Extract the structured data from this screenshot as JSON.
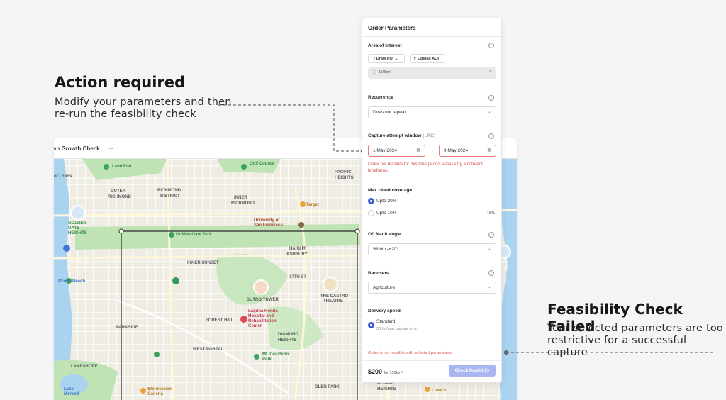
{
  "callouts": {
    "action": {
      "title": "Action required",
      "body_line1": "Modify your parameters and then",
      "body_line2": "re-run the feasibility check"
    },
    "failed": {
      "title": "Feasibility Check Failed",
      "body_line1": "Your selected parameters are too",
      "body_line2": "restrictive for a successful capture"
    }
  },
  "map_window": {
    "title": "ban Growth Check",
    "more_label": "···",
    "labels": [
      "Land End",
      "OUTER RICHMOND",
      "RICHMOND DISTRICT",
      "INNER RICHMOND",
      "Golf Course",
      "PACIFIC HEIGHTS",
      "University of San Francisco",
      "Target",
      "GOLDEN GATE HEIGHTS",
      "Golden Gate Park",
      "HAIGHT-ASHBURY",
      "INNER SUNSET",
      "17TH ST",
      "Ocean Beach",
      "SUTRO TOWER",
      "Laguna Honda Hospital and Rehabilitation Center",
      "THE CASTRO THEATRE",
      "PARKSIDE",
      "FOREST HILL",
      "DIAMOND HEIGHTS",
      "WEST PORTAL",
      "Mt. Davidson Park",
      "LAKESHORE",
      "Stonestown Galleria",
      "GLEN PARK",
      "BERNAL HEIGHTS",
      "Lowe's",
      "Lake Merced",
      "of Lobos"
    ]
  },
  "panel": {
    "title": "Order Parameters",
    "aoi": {
      "label": "Area of interest",
      "draw_label": "Draw AOI",
      "upload_label": "Upload AOI",
      "value": "150km²"
    },
    "recurrence": {
      "label": "Recurrence",
      "value": "Does not repeat"
    },
    "window": {
      "label": "Capture attempt window",
      "label_suffix": "(UTC)",
      "start": "1 May 2024",
      "end": "9 May 2024",
      "error": "Order not feasible for this time period. Please try a different timeframe."
    },
    "cloud": {
      "label": "Max cloud coverage",
      "options": [
        {
          "label": "Upto 20%",
          "selected": true
        },
        {
          "label": "Upto 10%",
          "selected": false,
          "badge": "↑15%"
        }
      ]
    },
    "nadir": {
      "label": "Off Nadir angle",
      "value": "Within -+20°"
    },
    "bands": {
      "label": "Bandsets",
      "value": "Agriculture"
    },
    "delivery": {
      "label": "Delivery speed",
      "option_label": "Standard",
      "option_sub": "36 hr from capture time"
    },
    "footer_error": "Order is not feasible with selected parameters.",
    "price": "$200",
    "price_note": "for 150km²",
    "check_button": "Check feasibility"
  },
  "colors": {
    "accent": "#3e5bd6",
    "error": "#d9534f",
    "map_park": "#bfe3b4",
    "map_land": "#f1efe9"
  }
}
